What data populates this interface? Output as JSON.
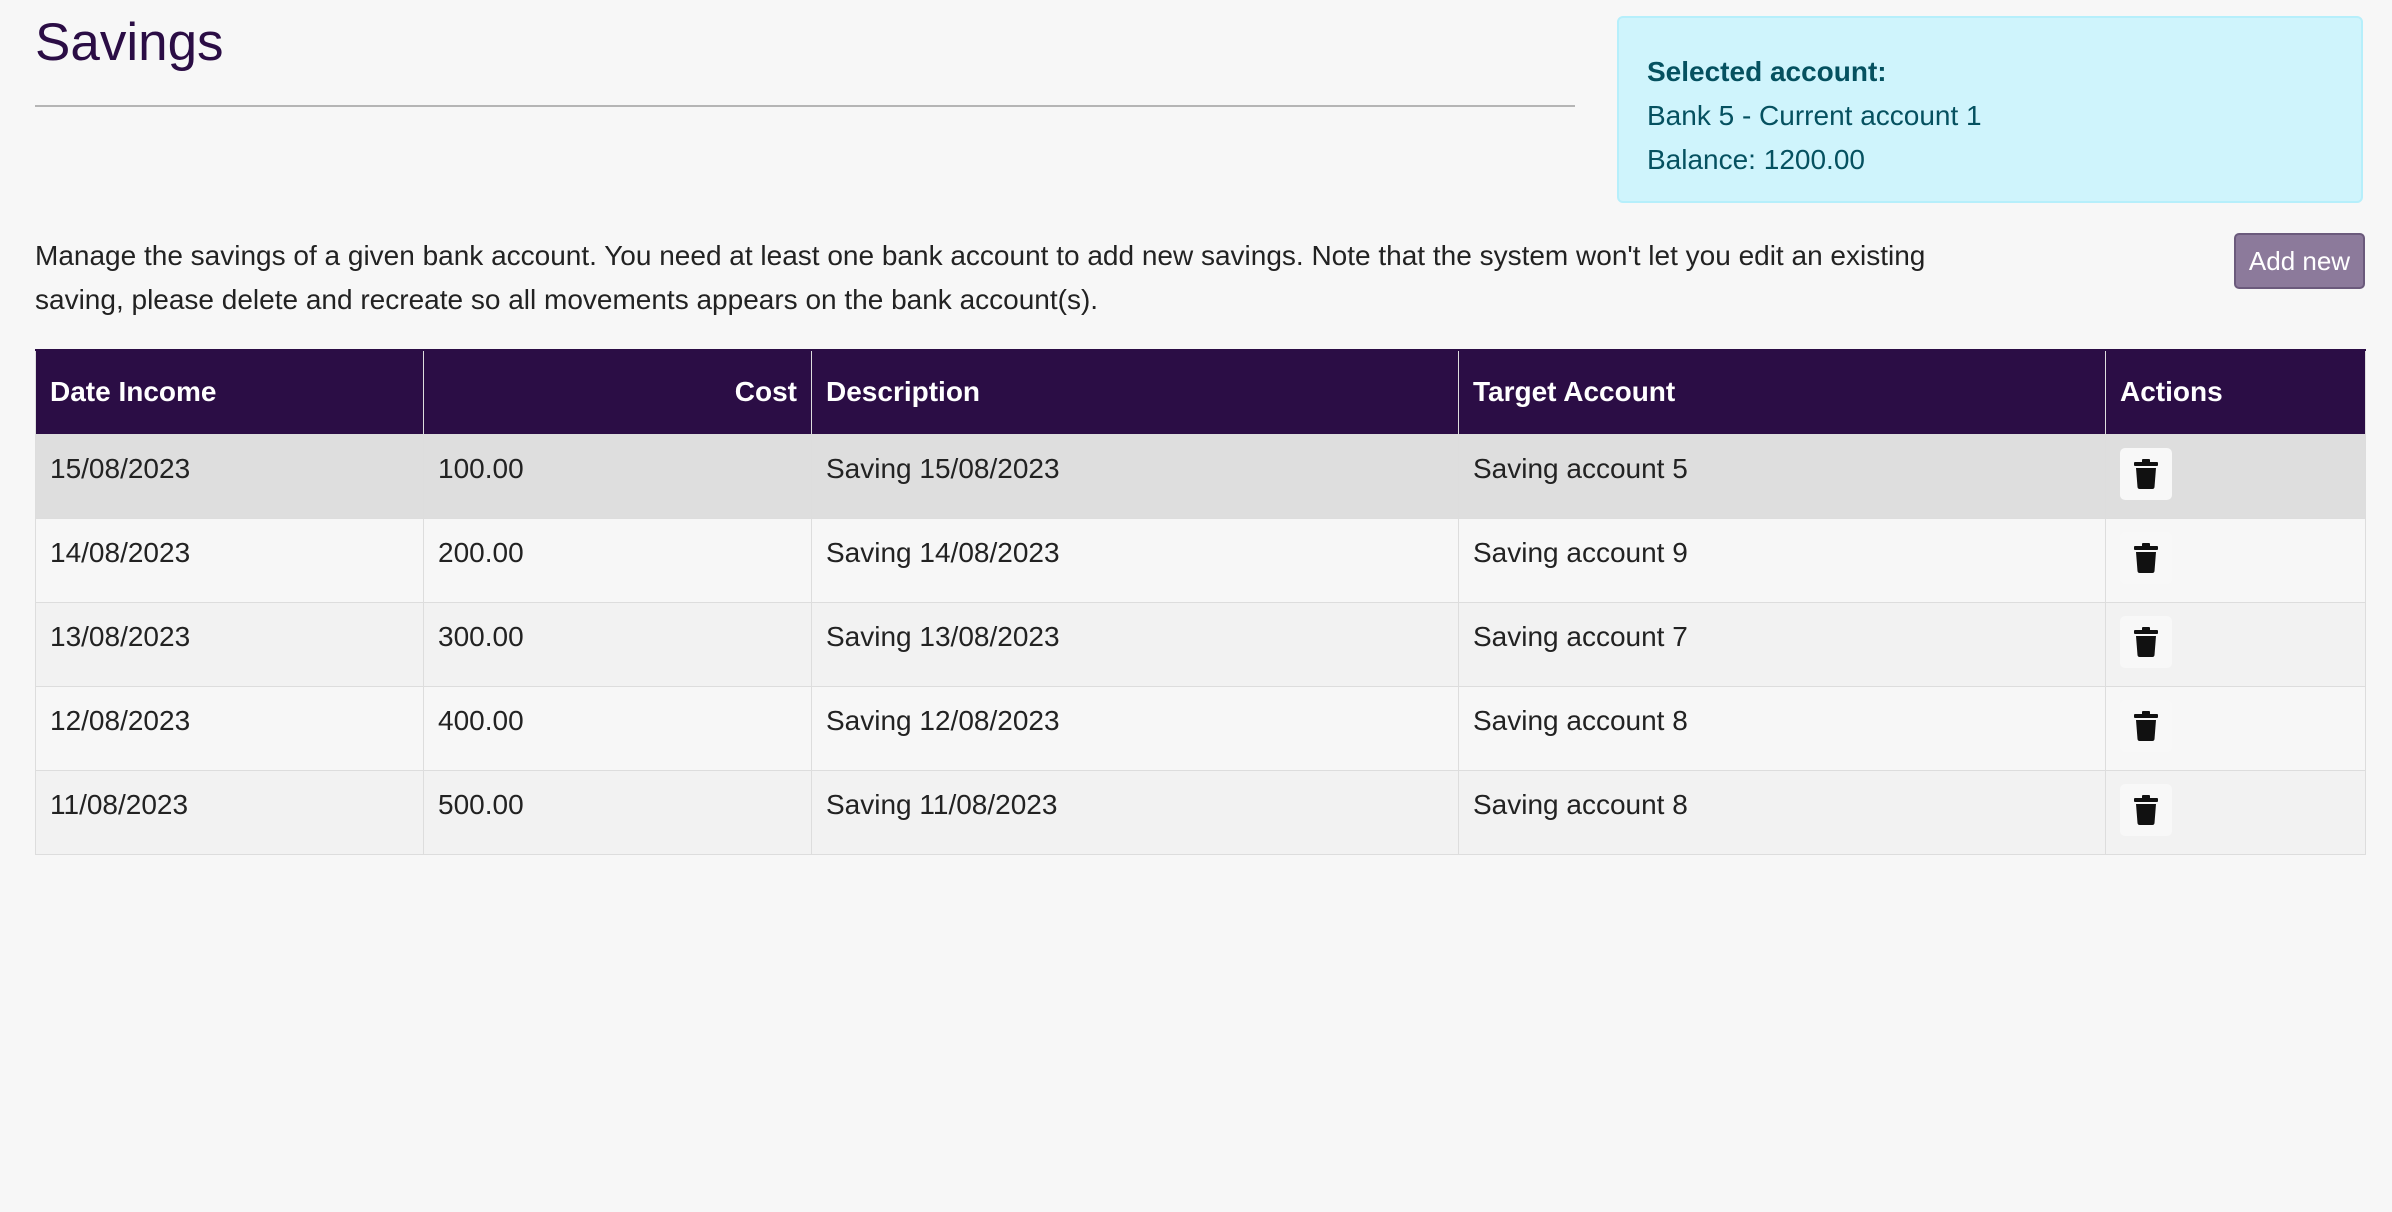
{
  "header": {
    "title": "Savings"
  },
  "selected_account": {
    "label": "Selected account:",
    "account": "Bank 5 - Current account 1",
    "balance": "Balance: 1200.00"
  },
  "intro": {
    "text": "Manage the savings of a given bank account. You need at least one bank account to add new savings. Note that the system won't let you edit an existing saving, please delete and recreate so all movements appears on the bank account(s)."
  },
  "actions": {
    "add_new_label": "Add new"
  },
  "table": {
    "columns": [
      "Date Income",
      "Cost",
      "Description",
      "Target Account",
      "Actions"
    ],
    "rows": [
      {
        "date": "15/08/2023",
        "cost": "100.00",
        "description": "Saving 15/08/2023",
        "target": "Saving account 5"
      },
      {
        "date": "14/08/2023",
        "cost": "200.00",
        "description": "Saving 14/08/2023",
        "target": "Saving account 9"
      },
      {
        "date": "13/08/2023",
        "cost": "300.00",
        "description": "Saving 13/08/2023",
        "target": "Saving account 7"
      },
      {
        "date": "12/08/2023",
        "cost": "400.00",
        "description": "Saving 12/08/2023",
        "target": "Saving account 8"
      },
      {
        "date": "11/08/2023",
        "cost": "500.00",
        "description": "Saving 11/08/2023",
        "target": "Saving account 8"
      }
    ],
    "row_action_icon": "trash-icon"
  },
  "colors": {
    "brand": "#2b0d45",
    "info_bg": "#cff4fc",
    "info_text": "#055160",
    "add_button": "#8c7a9b"
  }
}
